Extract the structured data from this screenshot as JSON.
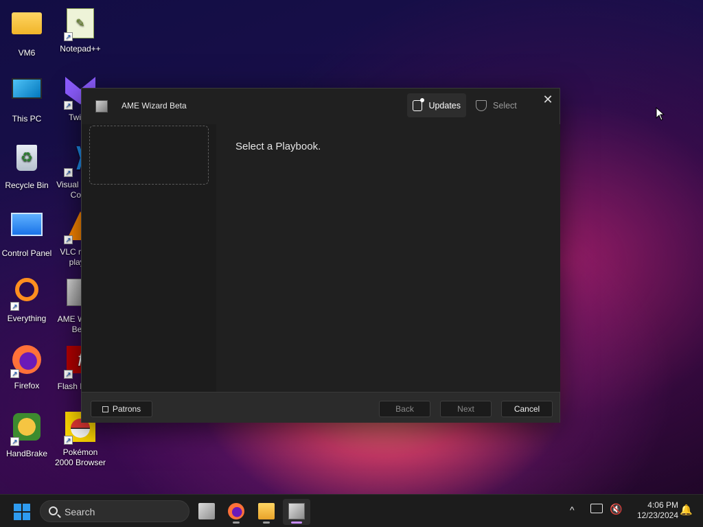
{
  "desktop": {
    "icons": [
      {
        "label": "VM6",
        "icon": "folder-icon"
      },
      {
        "label": "Notepad++",
        "icon": "notepadpp-icon"
      },
      {
        "label": "This PC",
        "icon": "computer-icon"
      },
      {
        "label": "Twitch",
        "icon": "twitch-icon"
      },
      {
        "label": "Recycle Bin",
        "icon": "recycle-bin-icon"
      },
      {
        "label": "Visual Studio Code",
        "icon": "vscode-icon"
      },
      {
        "label": "Control Panel",
        "icon": "control-panel-icon"
      },
      {
        "label": "VLC media player",
        "icon": "vlc-icon"
      },
      {
        "label": "Everything",
        "icon": "everything-icon"
      },
      {
        "label": "AME Wizard Beta",
        "icon": "ame-wizard-icon"
      },
      {
        "label": "Firefox",
        "icon": "firefox-icon"
      },
      {
        "label": "Flash Player",
        "icon": "flash-icon"
      },
      {
        "label": "HandBrake",
        "icon": "handbrake-icon"
      },
      {
        "label": "Pokémon 2000 Browser",
        "icon": "pokemon-icon"
      }
    ],
    "shortcut_glyph": "↗"
  },
  "window": {
    "title": "AME Wizard Beta",
    "updates_label": "Updates",
    "select_label": "Select",
    "close_glyph": "✕",
    "content_message": "Select a Playbook.",
    "footer": {
      "patrons_label": "Patrons",
      "back_label": "Back",
      "next_label": "Next",
      "cancel_label": "Cancel"
    }
  },
  "taskbar": {
    "search_placeholder": "Search",
    "clock_time": "4:06 PM",
    "clock_date": "12/23/2024",
    "tray_chevron": "^",
    "volume_glyph": "🔇",
    "bell_glyph": "🔔",
    "apps": [
      "task-view-icon",
      "firefox-icon",
      "file-explorer-icon",
      "ame-wizard-icon"
    ]
  },
  "colors": {
    "window_bg": "#202020",
    "footer_bg": "#2b2b2b",
    "taskbar_bg": "#1c1c1c",
    "start_blue": "#2e9bf0",
    "active_indicator": "#c78cff"
  }
}
